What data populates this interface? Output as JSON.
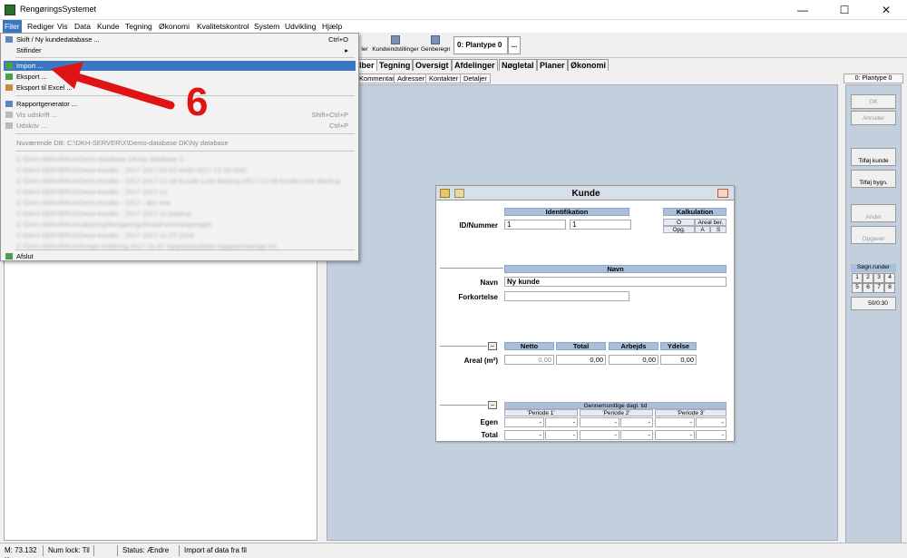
{
  "window": {
    "title": "RengøringsSystemet",
    "minimize": "—",
    "maximize": "☐",
    "close": "✕"
  },
  "menu": [
    "Filer",
    "Rediger",
    "Vis",
    "Data",
    "Kunde",
    "Tegning",
    "Økonomi",
    "Kvalitetskontrol",
    "System",
    "Udvikling",
    "Hjælp"
  ],
  "toolbar": {
    "partial": "ler",
    "kundeindstillinger": "Kundeindstillinger",
    "genberegn": "Genberegn",
    "plantype": "0: Plantype 0",
    "more": "..."
  },
  "tabs": [
    "lber",
    "Tegning",
    "Oversigt",
    "Afdelinger",
    "Nøgletal",
    "Planer",
    "Økonomi"
  ],
  "subtabs": [
    "Kommentar",
    "Adresser",
    "Kontakter",
    "Detaljer"
  ],
  "dropdown": {
    "items": [
      {
        "label": "Skift / Ny kundedatabase ...",
        "shortcut": "Ctrl+O"
      },
      {
        "label": "Stifinder",
        "shortcut": "▸"
      },
      {
        "label": "Import ...",
        "shortcut": ""
      },
      {
        "label": "Eksport ...",
        "shortcut": ""
      },
      {
        "label": "Eksport til Excel ...",
        "shortcut": ""
      },
      {
        "label": "Rapportgenerator ...",
        "shortcut": ""
      },
      {
        "label": "Vis udskrift ...",
        "shortcut": "Shift+Ctrl+P"
      },
      {
        "label": "Udskriv ...",
        "shortcut": "Ctrl+P"
      },
      {
        "label": "Nuværende DB: C:\\DKH-SERVER\\X\\Demo-database DK\\Ny database",
        "shortcut": ""
      },
      {
        "label": "C:\\DKH-SERVER\\X\\Demo-database DK\\Ny database 2",
        "shortcut": ""
      },
      {
        "label": "C:\\DKH-SERVER\\X\\Demo-kunder - 2017-2017-01-07-KND-2017-12-26 KND",
        "shortcut": ""
      },
      {
        "label": "C:\\DKH-SERVER\\X\\Demo-kunder - 2017-2017-12-26 Kunde-Liste-Backup-2017-12-28 Kunde-Liste-Backup",
        "shortcut": ""
      },
      {
        "label": "C:\\DKH-SERVER\\X\\Demo-kunder - 2017-2017-12",
        "shortcut": ""
      },
      {
        "label": "C:\\DKH-SERVER\\X\\Demo-kunder - 2017 - den ene",
        "shortcut": ""
      },
      {
        "label": "C:\\DKH-SERVER\\X\\Demo-kunder - 2017-2017-11-backup",
        "shortcut": ""
      },
      {
        "label": "C:\\DKH-SERVER\\X\\Udlejning\\Rengøringsfirma\\Forretningsregler",
        "shortcut": ""
      },
      {
        "label": "C:\\DKH-SERVER\\X\\Demo-kunder - 2017-2017-11-27-2018",
        "shortcut": ""
      },
      {
        "label": "C:\\DKH-SERVER\\X\\Renate-Foldning-2017-11-07-Sagsforbindelse-Opgaveoversigt DK",
        "shortcut": ""
      },
      {
        "label": "Afslut",
        "shortcut": ""
      }
    ]
  },
  "annotation": {
    "number": "6"
  },
  "card": {
    "title": "Kunde",
    "identifikation": "Identifikation",
    "kalkulation": "Kalkulation",
    "kalk_o": "O",
    "kalk_areal": "Areal ber.",
    "kalk_opg": "Opg.",
    "kalk_a": "A",
    "kalk_s": "S",
    "id_label": "ID/Nummer",
    "id_value1": "1",
    "id_value2": "1",
    "navn_header": "Navn",
    "navn_label": "Navn",
    "navn_value": "Ny kunde",
    "forkortelse_label": "Forkortelse",
    "forkortelse_value": "",
    "netto": "Netto",
    "total": "Total",
    "arbejds": "Arbejds",
    "ydelse": "Ydelse",
    "areal_label": "Areal (m²)",
    "areal_netto": "0,00",
    "areal_total": "0,00",
    "areal_arbejds": "0,00",
    "areal_ydelse": "0,00",
    "gennemsnit": "Gennemsnitlige dagl. tid",
    "periode1": "'Periode 1'",
    "periode2": "'Periode 2'",
    "periode3": "'Periode 3'",
    "egen_label": "Egen",
    "total_label": "Total",
    "dash": "-",
    "collapse": "–"
  },
  "right": {
    "plantype": "0: Plantype 0",
    "ok": "OK",
    "annuller": "Annuller",
    "tilfoej_kunde": "Tilføj kunde",
    "tilfoej_bygn": "Tilføj bygn.",
    "andet": "Andet",
    "opgaver": "Opgaver",
    "soegn_runder": "Søgn.runder",
    "runder": [
      "1",
      "2",
      "3",
      "4",
      "5",
      "6",
      "7",
      "8"
    ],
    "counter": "50/0:30"
  },
  "status": {
    "memory": "M: 73.132 K",
    "numlock": "Num lock: Til",
    "blank": "",
    "status": "Status: Ændre",
    "message": "Import af data fra fil"
  }
}
